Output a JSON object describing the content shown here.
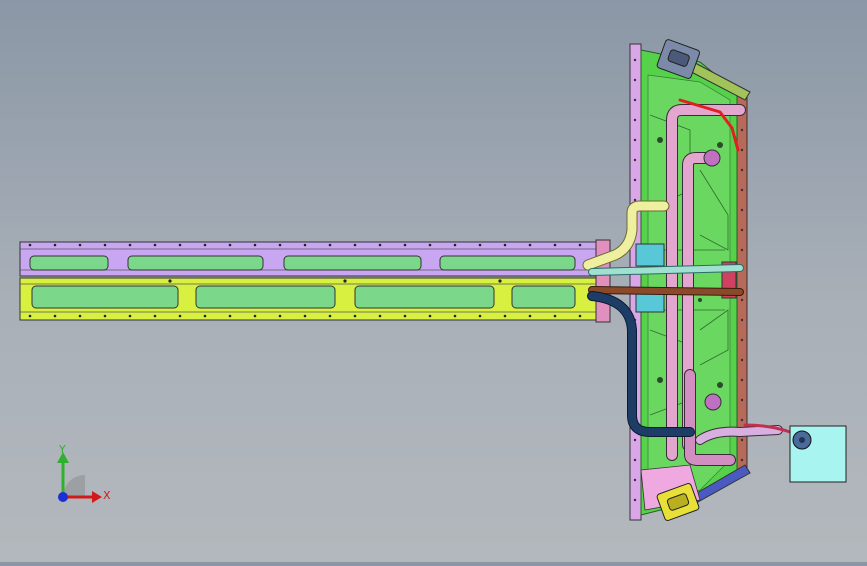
{
  "viewport": {
    "background_top": "#8b97a6",
    "background_bottom": "#b3b8bd"
  },
  "triad": {
    "x_label": "X",
    "y_label": "Y",
    "x_color": "#d11b1b",
    "y_color": "#2fb12f",
    "z_color": "#1b2fd6"
  },
  "model": {
    "arm_upper_color": "#c9a6f2",
    "arm_lower_color": "#d8f040",
    "slot_color": "#7bd88b",
    "plate_color": "#56d24a",
    "frame_color": "#d9a6e8",
    "pipe_pink": "#e2a6cf",
    "pipe_cream": "#eef0a0",
    "pipe_teal": "#9fe0d0",
    "pipe_brown": "#8a4a2a",
    "pipe_navy": "#1d3d66",
    "box_color": "#a8f4f0",
    "handle_top_color": "#7a8aa8",
    "handle_bottom_color": "#e8e038"
  }
}
